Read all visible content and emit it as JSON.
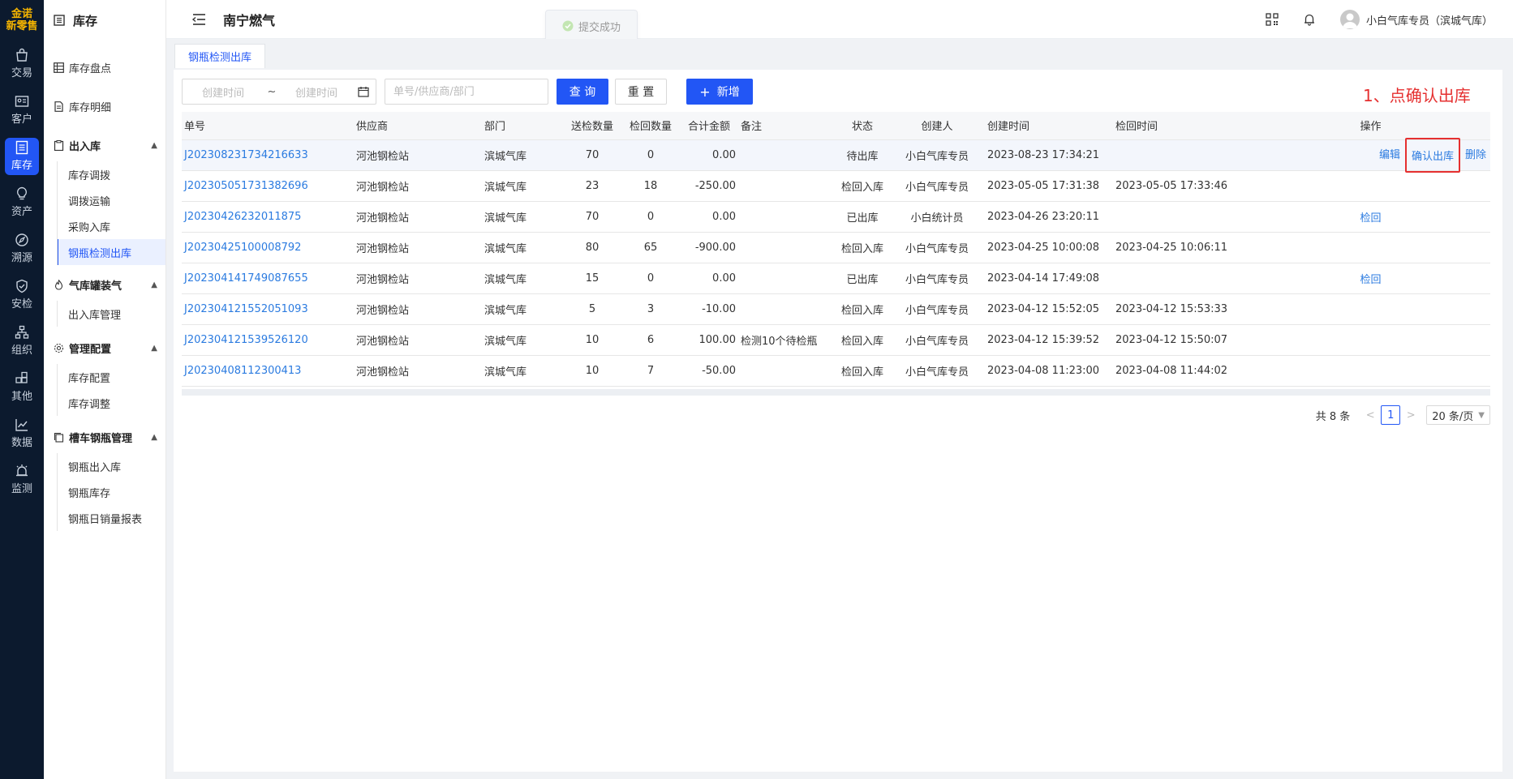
{
  "logo": {
    "line1": "金诺",
    "line2": "新零售"
  },
  "rail": [
    {
      "label": "交易",
      "icon": "bag-icon"
    },
    {
      "label": "客户",
      "icon": "id-card-icon"
    },
    {
      "label": "库存",
      "icon": "list-doc-icon",
      "active": true
    },
    {
      "label": "资产",
      "icon": "bulb-icon"
    },
    {
      "label": "溯源",
      "icon": "compass-icon"
    },
    {
      "label": "安检",
      "icon": "shield-check-icon"
    },
    {
      "label": "组织",
      "icon": "org-tree-icon"
    },
    {
      "label": "其他",
      "icon": "apps-icon"
    },
    {
      "label": "数据",
      "icon": "line-chart-icon"
    },
    {
      "label": "监测",
      "icon": "alarm-icon"
    }
  ],
  "sidebar": {
    "title": "库存",
    "links": [
      "库存盘点",
      "库存明细"
    ],
    "groups": [
      {
        "label": "出入库",
        "items": [
          "库存调拨",
          "调拨运输",
          "采购入库",
          "钢瓶检测出库"
        ]
      },
      {
        "label": "气库罐装气",
        "items": [
          "出入库管理"
        ]
      },
      {
        "label": "管理配置",
        "items": [
          "库存配置",
          "库存调整"
        ]
      },
      {
        "label": "槽车钢瓶管理",
        "items": [
          "钢瓶出入库",
          "钢瓶库存",
          "钢瓶日销量报表"
        ]
      }
    ]
  },
  "header": {
    "org": "南宁燃气",
    "toast": "提交成功",
    "user": "小白气库专员（滨城气库）"
  },
  "tab": "钢瓶检测出库",
  "toolbar": {
    "date_start": "创建时间",
    "date_sep": "~",
    "date_end": "创建时间",
    "search_placeholder": "单号/供应商/部门",
    "query": "查 询",
    "reset": "重 置",
    "add": "新增"
  },
  "annotation": "1、点确认出库",
  "table": {
    "columns": [
      "单号",
      "供应商",
      "部门",
      "送检数量",
      "检回数量",
      "合计金额",
      "备注",
      "状态",
      "创建人",
      "创建时间",
      "检回时间",
      "操作"
    ],
    "rows": [
      {
        "no": "J202308231734216633",
        "supplier": "河池钢检站",
        "dept": "滨城气库",
        "sent": "70",
        "back": "0",
        "amount": "0.00",
        "note": "",
        "status": "待出库",
        "creator": "小白气库专员",
        "created": "2023-08-23 17:34:21",
        "returned": "",
        "ops": [
          "编辑",
          "确认出库",
          "删除"
        ]
      },
      {
        "no": "J202305051731382696",
        "supplier": "河池钢检站",
        "dept": "滨城气库",
        "sent": "23",
        "back": "18",
        "amount": "-250.00",
        "note": "",
        "status": "检回入库",
        "creator": "小白气库专员",
        "created": "2023-05-05 17:31:38",
        "returned": "2023-05-05 17:33:46",
        "ops": []
      },
      {
        "no": "J20230426232011875",
        "supplier": "河池钢检站",
        "dept": "滨城气库",
        "sent": "70",
        "back": "0",
        "amount": "0.00",
        "note": "",
        "status": "已出库",
        "creator": "小白统计员",
        "created": "2023-04-26 23:20:11",
        "returned": "",
        "ops": [
          "检回"
        ]
      },
      {
        "no": "J20230425100008792",
        "supplier": "河池钢检站",
        "dept": "滨城气库",
        "sent": "80",
        "back": "65",
        "amount": "-900.00",
        "note": "",
        "status": "检回入库",
        "creator": "小白气库专员",
        "created": "2023-04-25 10:00:08",
        "returned": "2023-04-25 10:06:11",
        "ops": []
      },
      {
        "no": "J202304141749087655",
        "supplier": "河池钢检站",
        "dept": "滨城气库",
        "sent": "15",
        "back": "0",
        "amount": "0.00",
        "note": "",
        "status": "已出库",
        "creator": "小白气库专员",
        "created": "2023-04-14 17:49:08",
        "returned": "",
        "ops": [
          "检回"
        ]
      },
      {
        "no": "J202304121552051093",
        "supplier": "河池钢检站",
        "dept": "滨城气库",
        "sent": "5",
        "back": "3",
        "amount": "-10.00",
        "note": "",
        "status": "检回入库",
        "creator": "小白气库专员",
        "created": "2023-04-12 15:52:05",
        "returned": "2023-04-12 15:53:33",
        "ops": []
      },
      {
        "no": "J202304121539526120",
        "supplier": "河池钢检站",
        "dept": "滨城气库",
        "sent": "10",
        "back": "6",
        "amount": "100.00",
        "note": "检测10个待检瓶",
        "status": "检回入库",
        "creator": "小白气库专员",
        "created": "2023-04-12 15:39:52",
        "returned": "2023-04-12 15:50:07",
        "ops": []
      },
      {
        "no": "J20230408112300413",
        "supplier": "河池钢检站",
        "dept": "滨城气库",
        "sent": "10",
        "back": "7",
        "amount": "-50.00",
        "note": "",
        "status": "检回入库",
        "creator": "小白气库专员",
        "created": "2023-04-08 11:23:00",
        "returned": "2023-04-08 11:44:02",
        "ops": []
      }
    ]
  },
  "pager": {
    "total": "共 8 条",
    "prev": "<",
    "page": "1",
    "next": ">",
    "size": "20 条/页"
  },
  "colors": {
    "primary": "#2256f5",
    "link": "#2b7be0",
    "annotation": "#e53030",
    "rail": "#0c1a2e"
  }
}
